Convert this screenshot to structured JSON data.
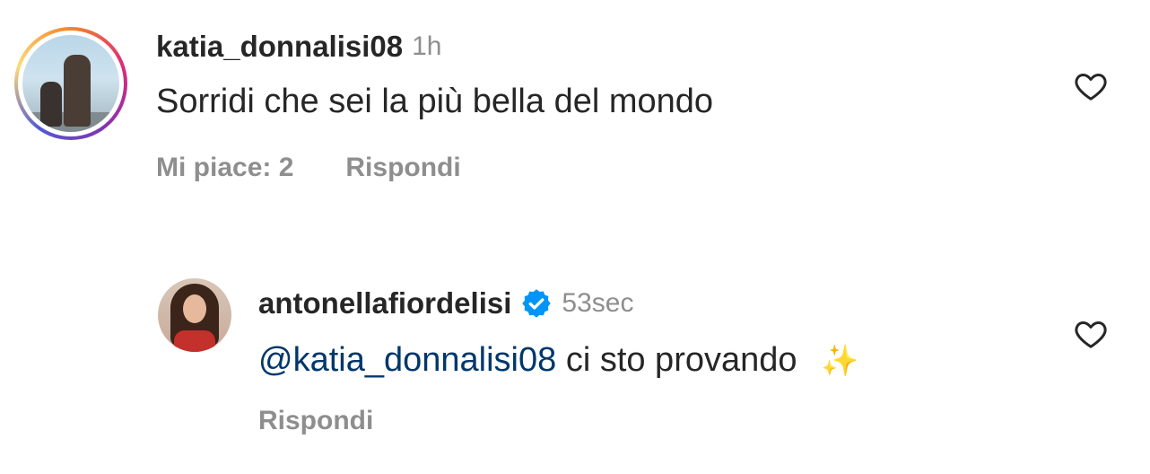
{
  "comments": [
    {
      "username": "katia_donnalisi08",
      "time": "1h",
      "text": "Sorridi che sei la più bella del mondo",
      "likes_label": "Mi piace: 2",
      "reply_label": "Rispondi",
      "avatar_icon": "user-avatar-story-ring",
      "like_icon": "heart-outline-icon"
    },
    {
      "username": "antonellafiordelisi",
      "verified": true,
      "time": "53sec",
      "mention": "@katia_donnalisi08",
      "text": "ci sto provando",
      "emoji": "✨",
      "reply_label": "Rispondi",
      "avatar_icon": "user-avatar",
      "verified_icon": "verified-badge-icon",
      "like_icon": "heart-outline-icon"
    }
  ],
  "colors": {
    "text": "#262626",
    "secondary": "#8e8e8e",
    "mention": "#00376b",
    "verified": "#0095f6"
  }
}
